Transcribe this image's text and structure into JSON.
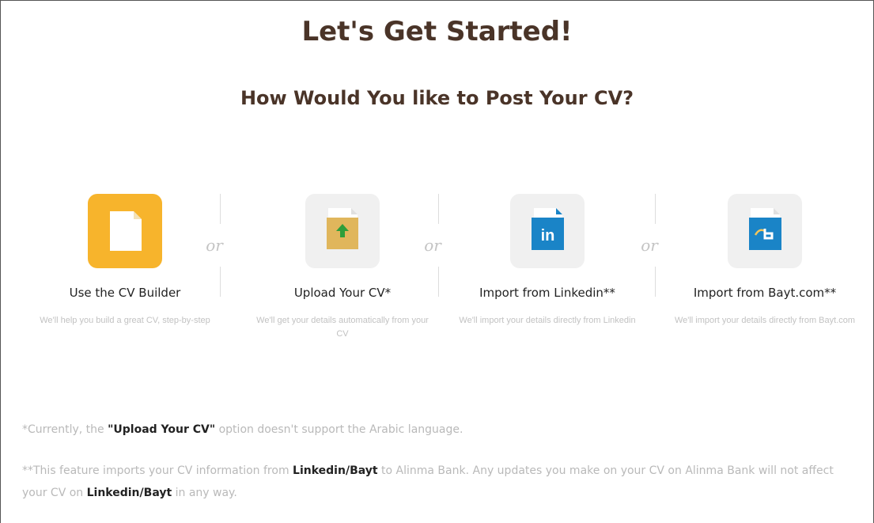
{
  "heading": {
    "title": "Let's Get Started!",
    "subtitle": "How Would You like to Post Your CV?"
  },
  "separator_text": "or",
  "options": [
    {
      "label": "Use the CV Builder",
      "description": "We'll help you build a great CV, step-by-step",
      "icon": "document-icon"
    },
    {
      "label": "Upload Your CV*",
      "description": "We'll get your details automatically from your CV",
      "icon": "upload-document-icon"
    },
    {
      "label": "Import from Linkedin**",
      "description": "We'll import your details directly from Linkedin",
      "icon": "linkedin-document-icon"
    },
    {
      "label": "Import from Bayt.com**",
      "description": "We'll import your details directly from Bayt.com",
      "icon": "bayt-document-icon"
    }
  ],
  "notes": {
    "upload": {
      "before": "*Currently, the ",
      "strong": "\"Upload Your CV\"",
      "after": " option doesn't support the Arabic language."
    },
    "import": {
      "before": "**This feature imports your CV information from ",
      "strong1": "Linkedin/Bayt",
      "middle": " to Alinma Bank. Any updates you make on your CV on Alinma Bank will not affect your CV on ",
      "strong2": "Linkedin/Bayt",
      "after": " in any way."
    }
  },
  "colors": {
    "title": "#4a3428",
    "accent": "#f7b42c",
    "tile": "#f0f0f0",
    "linkedin": "#1a84c7",
    "bayt": "#1a84c7",
    "upload_arrow": "#2e9e3a"
  }
}
